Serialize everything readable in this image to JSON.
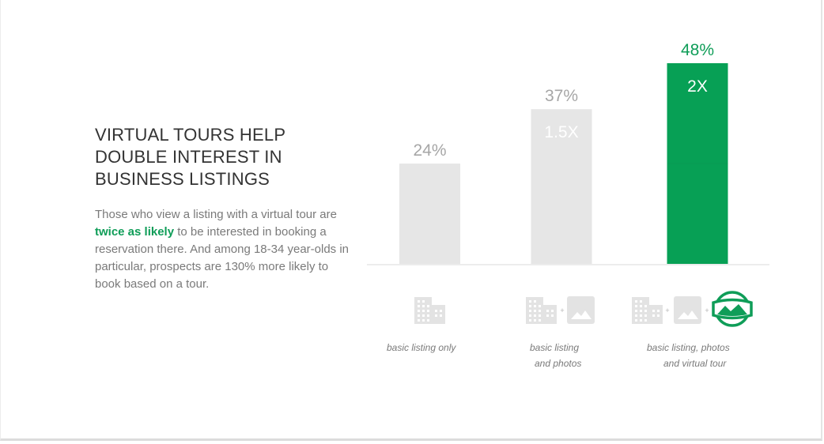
{
  "headline": {
    "lines": [
      "VIRTUAL TOURS HELP",
      "DOUBLE INTEREST IN",
      "BUSINESS LISTINGS"
    ]
  },
  "body": {
    "before": "Those who view a listing with a virtual tour are ",
    "highlight": "twice as likely",
    "after": " to be interested in booking a reservation there. And among 18-34 year-olds in particular, prospects are 130% more likely to book based on a tour."
  },
  "colors": {
    "accent": "#0f9d58",
    "bar_gray": "#e6e6e6",
    "bar_green": "#07a055",
    "label_gray": "#a6a6a6",
    "icon_gray": "#e3e3e3"
  },
  "chart_data": {
    "type": "bar",
    "title": "",
    "xlabel": "",
    "ylabel": "",
    "ylim": [
      0,
      48
    ],
    "grid": false,
    "categories": [
      "basic listing only",
      "basic listing and photos",
      "basic listing, photos and virtual tour"
    ],
    "category_label_lines": [
      [
        "basic listing only"
      ],
      [
        "basic listing",
        "and photos"
      ],
      [
        "basic listing, photos",
        "and virtual tour"
      ]
    ],
    "values": [
      24,
      37,
      48
    ],
    "value_labels": [
      "24%",
      "37%",
      "48%"
    ],
    "multiplier_labels": [
      "",
      "1.5X",
      "2X"
    ],
    "highlight_index": 2,
    "category_icons": [
      [
        "building-icon"
      ],
      [
        "building-icon",
        "photo-icon"
      ],
      [
        "building-icon",
        "photo-icon",
        "virtual-tour-icon"
      ]
    ],
    "icon_separator": "+"
  }
}
